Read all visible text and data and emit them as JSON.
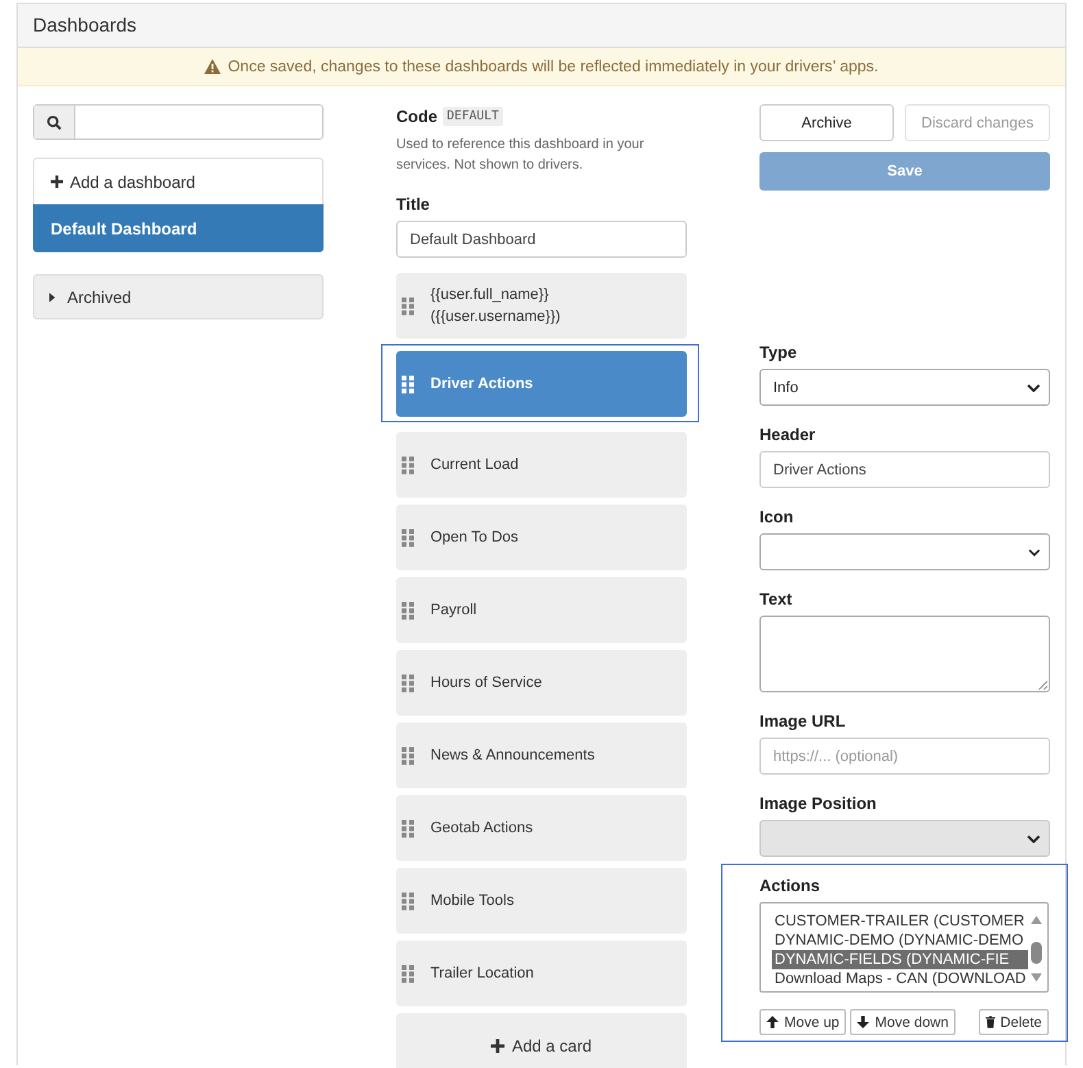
{
  "page_title": "Dashboards",
  "notice": "Once saved, changes to these dashboards will be reflected immediately in your drivers’ apps.",
  "dashboards": {
    "add_label": "Add a dashboard",
    "items": [
      {
        "label": "Default Dashboard",
        "selected": true
      }
    ]
  },
  "archived": {
    "label": "Archived",
    "expanded": false
  },
  "code": {
    "label": "Code",
    "value": "DEFAULT",
    "help": "Used to reference this dashboard in your services. Not shown to drivers."
  },
  "title_field": {
    "label": "Title",
    "value": "Default Dashboard"
  },
  "cards": [
    {
      "label": "{{user.full_name}} ({{user.username}})",
      "selected": false
    },
    {
      "label": "Driver Actions",
      "selected": true
    },
    {
      "label": "Current Load",
      "selected": false
    },
    {
      "label": "Open To Dos",
      "selected": false
    },
    {
      "label": "Payroll",
      "selected": false
    },
    {
      "label": "Hours of Service",
      "selected": false
    },
    {
      "label": "News & Announcements",
      "selected": false
    },
    {
      "label": "Geotab Actions",
      "selected": false
    },
    {
      "label": "Mobile Tools",
      "selected": false
    },
    {
      "label": "Trailer Location",
      "selected": false
    }
  ],
  "add_card": "Add a card",
  "archive_button": {
    "label": "Archive",
    "disabled": false
  },
  "discard_button": {
    "label": "Discard changes",
    "disabled": true
  },
  "save_button": {
    "label": "Save",
    "disabled": true
  },
  "card_editor": {
    "type": {
      "label": "Type",
      "value": "Info"
    },
    "header": {
      "label": "Header",
      "value": "Driver Actions"
    },
    "icon": {
      "label": "Icon"
    },
    "text": {
      "label": "Text"
    },
    "image_url": {
      "label": "Image URL",
      "placeholder": "https://... (optional)"
    },
    "image_position": {
      "label": "Image Position",
      "disabled": true
    },
    "actions": {
      "label": "Actions",
      "options": [
        {
          "label": "CUSTOMER-TRAILER (CUSTOMER",
          "selected": false
        },
        {
          "label": "DYNAMIC-DEMO (DYNAMIC-DEMO",
          "selected": false
        },
        {
          "label": "DYNAMIC-FIELDS (DYNAMIC-FIE",
          "selected": true
        },
        {
          "label": "Download Maps - CAN (DOWNLOAD",
          "selected": false
        }
      ],
      "buttons": [
        {
          "kind": "up",
          "label": "Move up"
        },
        {
          "kind": "down",
          "label": "Move down"
        },
        {
          "kind": "delete",
          "label": "Delete"
        }
      ]
    }
  }
}
